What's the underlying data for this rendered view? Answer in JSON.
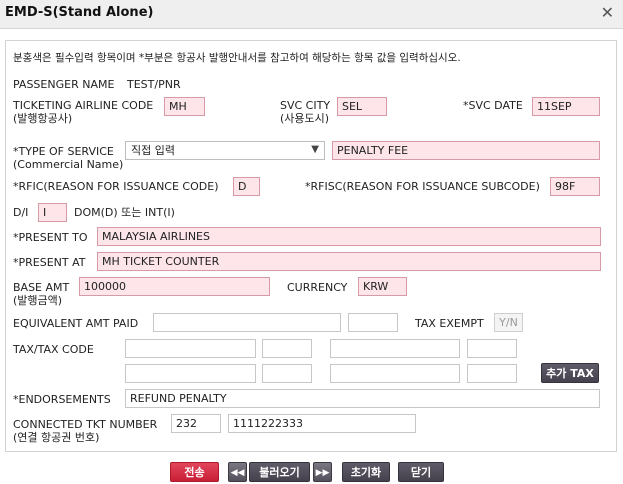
{
  "window": {
    "title": "EMD-S(Stand Alone)",
    "close_glyph": "✕"
  },
  "notice": "분홍색은 필수입력 항목이며 *부분은 항공사 발행안내서를 참고하여 해당하는 항목 값을 입력하십시오.",
  "passenger": {
    "label": "PASSENGER NAME",
    "value": "TEST/PNR"
  },
  "ticketing_airline": {
    "label": "TICKETING AIRLINE CODE",
    "sublabel": "(발행항공사)",
    "value": "MH"
  },
  "svc_city": {
    "label": "SVC CITY",
    "sublabel": "(사용도시)",
    "value": "SEL"
  },
  "svc_date": {
    "label": "*SVC DATE",
    "value": "11SEP"
  },
  "type_of_service": {
    "label": "*TYPE OF SERVICE",
    "sublabel": "(Commercial Name)",
    "select_value": "직접 입력",
    "value": "PENALTY FEE"
  },
  "rfic": {
    "label": "*RFIC(REASON FOR ISSUANCE CODE)",
    "value": "D"
  },
  "rfisc": {
    "label": "*RFISC(REASON FOR ISSUANCE SUBCODE)",
    "value": "98F"
  },
  "di": {
    "label": "D/I",
    "value": "I",
    "hint": "DOM(D)  또는  INT(I)"
  },
  "present_to": {
    "label": "*PRESENT TO",
    "value": "MALAYSIA AIRLINES"
  },
  "present_at": {
    "label": "*PRESENT AT",
    "value": "MH TICKET COUNTER"
  },
  "base_amt": {
    "label": "BASE AMT",
    "sublabel": "(발행금액)",
    "value": "100000"
  },
  "currency": {
    "label": "CURRENCY",
    "value": "KRW"
  },
  "equivalent": {
    "label": "EQUIVALENT AMT PAID",
    "value": "",
    "currency": ""
  },
  "tax_exempt": {
    "label": "TAX EXEMPT",
    "value": "Y/N"
  },
  "tax": {
    "label": "TAX/TAX CODE",
    "add_button": "추가 TAX"
  },
  "endorsements": {
    "label": "*ENDORSEMENTS",
    "value": "REFUND PENALTY"
  },
  "connected_tkt": {
    "label": "CONNECTED TKT NUMBER",
    "sublabel": "(연결 항공권 번호)",
    "prefix": "232",
    "number": "1111222333"
  },
  "footer": {
    "submit": "전송",
    "prev": "◀◀",
    "load": "불러오기",
    "next": "▶▶",
    "reset": "초기화",
    "close": "닫기"
  },
  "colors": {
    "required_field": "#fde5ea",
    "submit_button": "#c91f36",
    "dark_button": "#45414d"
  }
}
